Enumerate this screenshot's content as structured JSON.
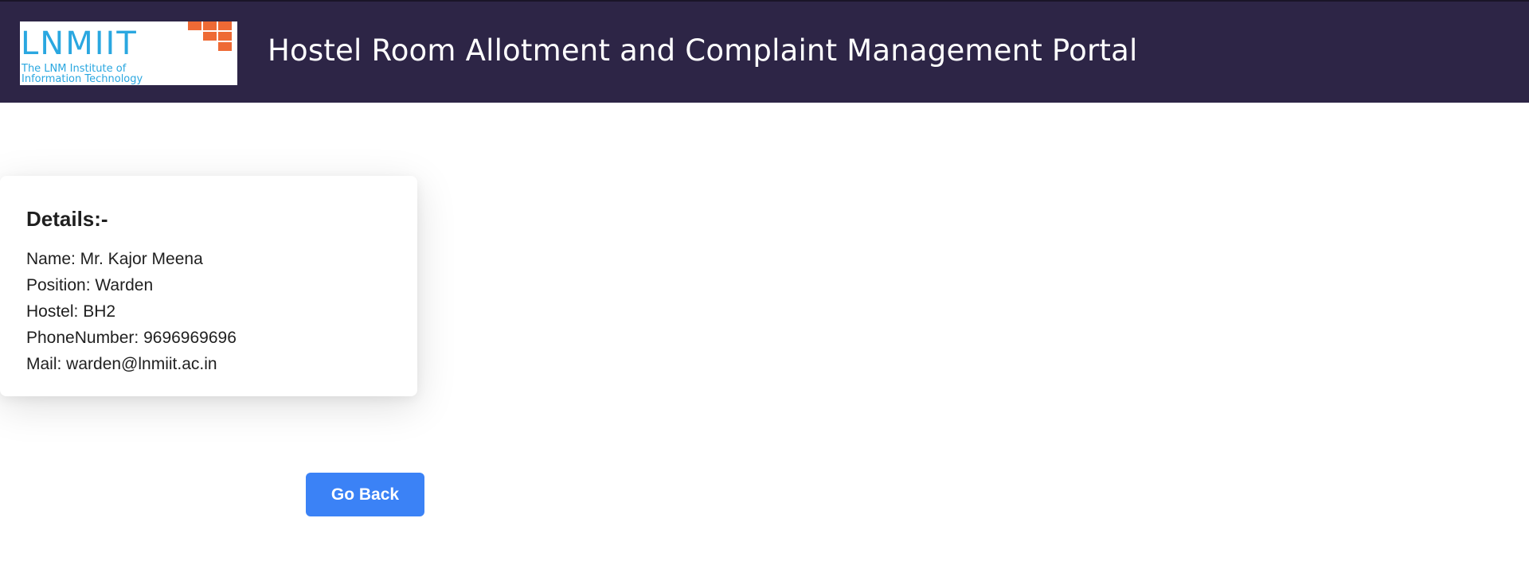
{
  "header": {
    "logo": {
      "wordmark": "LNMIIT",
      "subtitle_line1": "The LNM Institute of",
      "subtitle_line2": "Information Technology",
      "icon": "lnmiit-logo-icon",
      "colors": {
        "text": "#2aa7e0",
        "squares": "#ee6a35"
      }
    },
    "title": "Hostel Room Allotment and Complaint Management Portal",
    "background_color": "#2d2546"
  },
  "details": {
    "heading": "Details:-",
    "rows": [
      "Name: Mr. Kajor Meena",
      "Position: Warden",
      "Hostel: BH2",
      "PhoneNumber: 9696969696",
      "Mail: warden@lnmiit.ac.in"
    ]
  },
  "actions": {
    "go_back_label": "Go Back",
    "button_color": "#3b82f6"
  }
}
